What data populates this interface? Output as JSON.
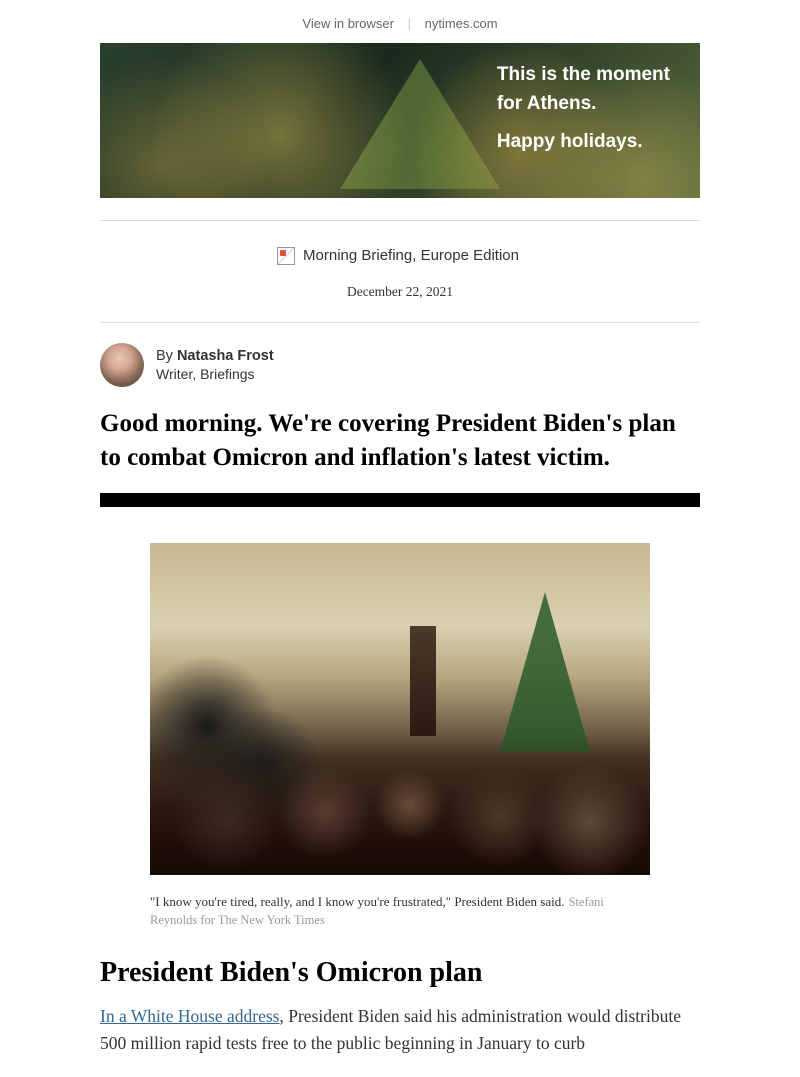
{
  "topLinks": {
    "viewInBrowser": "View in browser",
    "siteName": "nytimes.com"
  },
  "ad": {
    "line1": "This is the moment",
    "line2": "for Athens.",
    "line3": "Happy holidays."
  },
  "logo": {
    "altText": "Morning Briefing, Europe Edition"
  },
  "date": "December 22, 2021",
  "byline": {
    "byPrefix": "By ",
    "author": "Natasha Frost",
    "role": "Writer, Briefings"
  },
  "headline": "Good morning. We're covering President Biden's plan to combat Omicron and inflation's latest victim.",
  "articleImage": {
    "caption": "\"I know you're tired, really, and I know you're frustrated,\" President Biden said.",
    "credit": "Stefani Reynolds for The New York Times"
  },
  "article": {
    "title": "President Biden's Omicron plan",
    "linkText": "In a White House address",
    "bodyAfterLink": ", President Biden said his administration would distribute 500 million rapid tests free to the public beginning in January to curb"
  }
}
